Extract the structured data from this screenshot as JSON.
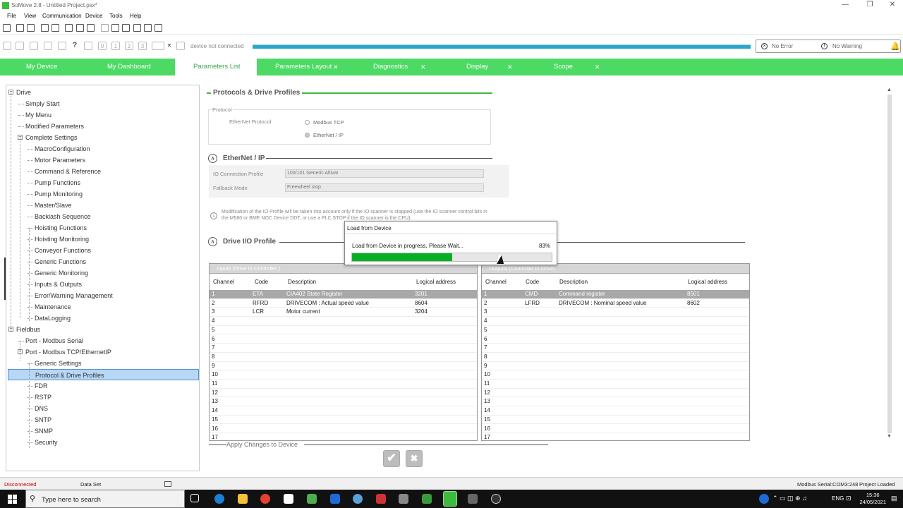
{
  "window": {
    "title": "SoMove 2.8 - Untitled Project.psx*",
    "minimize": "—",
    "restore": "❐",
    "close": "✕"
  },
  "menu": [
    "File",
    "View",
    "Communication",
    "Device",
    "Tools",
    "Help"
  ],
  "toolbar2": {
    "buttons": [
      "0",
      "1",
      "2",
      "3"
    ],
    "help": "?",
    "connection_status": "device not connected"
  },
  "status_box": {
    "error": "No Error",
    "warning": "No Warning"
  },
  "tabs": [
    {
      "label": "My Device",
      "active": false,
      "closable": false
    },
    {
      "label": "My Dashboard",
      "active": false,
      "closable": false
    },
    {
      "label": "Parameters List",
      "active": true,
      "closable": false
    },
    {
      "label": "Parameters Layout",
      "active": false,
      "closable": true
    },
    {
      "label": "Diagnostics",
      "active": false,
      "closable": true
    },
    {
      "label": "Display",
      "active": false,
      "closable": true
    },
    {
      "label": "Scope",
      "active": false,
      "closable": true
    }
  ],
  "tree": [
    {
      "label": "Drive",
      "level": 0,
      "expander": "−"
    },
    {
      "label": "Simply Start",
      "level": 1
    },
    {
      "label": "My Menu",
      "level": 1
    },
    {
      "label": "Modified Parameters",
      "level": 1
    },
    {
      "label": "Complete Settings",
      "level": 1,
      "expander": "−"
    },
    {
      "label": "MacroConfiguration",
      "level": 2
    },
    {
      "label": "Motor Parameters",
      "level": 2
    },
    {
      "label": "Command & Reference",
      "level": 2
    },
    {
      "label": "Pump Functions",
      "level": 2
    },
    {
      "label": "Pump Monitoring",
      "level": 2
    },
    {
      "label": "Master/Slave",
      "level": 2
    },
    {
      "label": "Backlash Sequence",
      "level": 2
    },
    {
      "label": "Hoisting Functions",
      "level": 2
    },
    {
      "label": "Hoisting Monitoring",
      "level": 2
    },
    {
      "label": "Conveyor Functions",
      "level": 2
    },
    {
      "label": "Generic Functions",
      "level": 2
    },
    {
      "label": "Generic Monitoring",
      "level": 2
    },
    {
      "label": "Inputs & Outputs",
      "level": 2
    },
    {
      "label": "Error/Warning Management",
      "level": 2
    },
    {
      "label": "Maintenance",
      "level": 2
    },
    {
      "label": "DataLogging",
      "level": 2
    },
    {
      "label": "Fieldbus",
      "level": 0,
      "expander": "−"
    },
    {
      "label": "Port - Modbus Serial",
      "level": 1
    },
    {
      "label": "Port - Modbus TCP/EthernetIP",
      "level": 1,
      "expander": "−"
    },
    {
      "label": "Generic Settings",
      "level": 2
    },
    {
      "label": "Protocol & Drive Profiles",
      "level": 2,
      "selected": true
    },
    {
      "label": "FDR",
      "level": 2
    },
    {
      "label": "RSTP",
      "level": 2
    },
    {
      "label": "DNS",
      "level": 2
    },
    {
      "label": "SNTP",
      "level": 2
    },
    {
      "label": "SNMP",
      "level": 2
    },
    {
      "label": "Security",
      "level": 2
    }
  ],
  "main": {
    "section1": "Protocols & Drive Profiles",
    "protocol_group": "Protocol",
    "ethernet_protocol_label": "EtherNet Protocol",
    "options": [
      "Modbus TCP",
      "EtherNet / IP"
    ],
    "section2": "EtherNet / IP",
    "io_profile_label": "IO Connection Profile",
    "io_profile_value": "100/101 Generic Altivar",
    "fallback_label": "Fallback Mode",
    "fallback_value": "Freewheel stop",
    "note": "Modification of the IO Profile will be taken into account only if the IO scanner is stopped (use the IO scanner control bits in the M580 or BME NOC Device DDT, or use a PLC STOP if the IO scanner is the CPU).",
    "info_icon": "i",
    "section3": "Drive I/O Profile",
    "collapse_icon": "∧",
    "apply_label": "Apply Changes to Device"
  },
  "inputs_table": {
    "title": "Inputs (Drive to Controller )",
    "columns": [
      "Channel",
      "Code",
      "Description",
      "Logical address"
    ],
    "rows": [
      [
        "1",
        "ETA",
        "CIA402 State Register",
        "3201"
      ],
      [
        "2",
        "RFRD",
        "DRIVECOM : Actual speed value",
        "8604"
      ],
      [
        "3",
        "LCR",
        "Motor current",
        "3204"
      ],
      [
        "4",
        "",
        "",
        ""
      ],
      [
        "5",
        "",
        "",
        ""
      ],
      [
        "6",
        "",
        "",
        ""
      ],
      [
        "7",
        "",
        "",
        ""
      ],
      [
        "8",
        "",
        "",
        ""
      ],
      [
        "9",
        "",
        "",
        ""
      ],
      [
        "10",
        "",
        "",
        ""
      ],
      [
        "11",
        "",
        "",
        ""
      ],
      [
        "12",
        "",
        "",
        ""
      ],
      [
        "13",
        "",
        "",
        ""
      ],
      [
        "14",
        "",
        "",
        ""
      ],
      [
        "15",
        "",
        "",
        ""
      ],
      [
        "16",
        "",
        "",
        ""
      ],
      [
        "17",
        "",
        "",
        ""
      ]
    ]
  },
  "outputs_table": {
    "title": "Outputs (Controller to Drive)",
    "columns": [
      "Channel",
      "Code",
      "Description",
      "Logical address"
    ],
    "rows": [
      [
        "1",
        "CMD",
        "Command register",
        "8501"
      ],
      [
        "2",
        "LFRD",
        "DRIVECOM : Nominal speed value",
        "8602"
      ],
      [
        "3",
        "",
        "",
        ""
      ],
      [
        "4",
        "",
        "",
        ""
      ],
      [
        "5",
        "",
        "",
        ""
      ],
      [
        "6",
        "",
        "",
        ""
      ],
      [
        "7",
        "",
        "",
        ""
      ],
      [
        "8",
        "",
        "",
        ""
      ],
      [
        "9",
        "",
        "",
        ""
      ],
      [
        "10",
        "",
        "",
        ""
      ],
      [
        "11",
        "",
        "",
        ""
      ],
      [
        "12",
        "",
        "",
        ""
      ],
      [
        "13",
        "",
        "",
        ""
      ],
      [
        "14",
        "",
        "",
        ""
      ],
      [
        "15",
        "",
        "",
        ""
      ],
      [
        "16",
        "",
        "",
        ""
      ],
      [
        "17",
        "",
        "",
        ""
      ]
    ]
  },
  "dialog": {
    "title": "Load from Device",
    "message": "Load from Device in progress, Please Wait...",
    "percent_text": "83%",
    "progress": 0.5
  },
  "buttons": {
    "apply": "✔",
    "cancel": "✖"
  },
  "statusbar": {
    "connection": "Disconnected",
    "dataset": "Data Set",
    "port": "Modbus Serial:COM3:248",
    "project": "Project Loaded"
  },
  "taskbar": {
    "search_placeholder": "Type here to search",
    "lang": "ENG",
    "time": "15:36",
    "date": "24/05/2021"
  },
  "colors": {
    "accent_green": "#4cd964",
    "progress_green": "#06b025",
    "selection_blue": "#b7d7f5",
    "connect_bar": "#2aa6c9"
  }
}
